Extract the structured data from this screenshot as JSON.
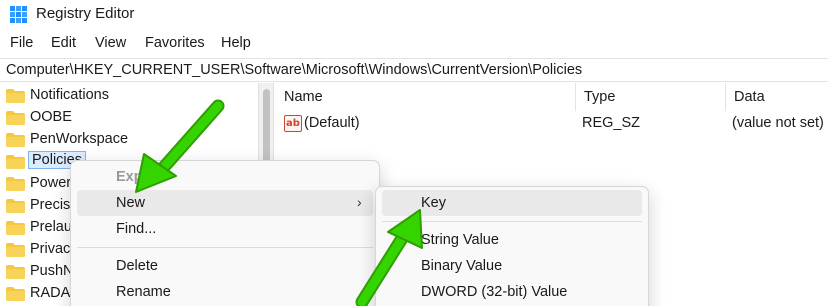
{
  "window": {
    "title": "Registry Editor",
    "icon": "registry-editor-icon"
  },
  "menubar": {
    "items": [
      "File",
      "Edit",
      "View",
      "Favorites",
      "Help"
    ]
  },
  "address": {
    "path": "Computer\\HKEY_CURRENT_USER\\Software\\Microsoft\\Windows\\CurrentVersion\\Policies"
  },
  "tree": {
    "items": [
      "Notifications",
      "OOBE",
      "PenWorkspace",
      "Policies",
      "Power",
      "Precisi",
      "Prelau",
      "Privac",
      "PushN",
      "RADA"
    ],
    "selected": "Policies"
  },
  "list": {
    "columns": [
      "Name",
      "Type",
      "Data"
    ],
    "rows": [
      {
        "name": "(Default)",
        "type": "REG_SZ",
        "data": "(value not set)"
      }
    ]
  },
  "context_menu": {
    "items": [
      "Expa",
      "New",
      "Find...",
      "Delete",
      "Rename"
    ],
    "disabled": "Expa",
    "highlighted": "New"
  },
  "submenu": {
    "items": [
      "Key",
      "String Value",
      "Binary Value",
      "DWORD (32-bit) Value"
    ],
    "highlighted": "Key"
  },
  "colors": {
    "arrow": "#33d400",
    "selection": "#dcecff",
    "selection_border": "#7eb4ea",
    "folder": "#f5c842"
  },
  "icons": {
    "string-value": "ab-icon",
    "folder": "folder-icon",
    "submenu-chevron": "chevron-right-icon",
    "annotation": "green-arrow-icon"
  }
}
